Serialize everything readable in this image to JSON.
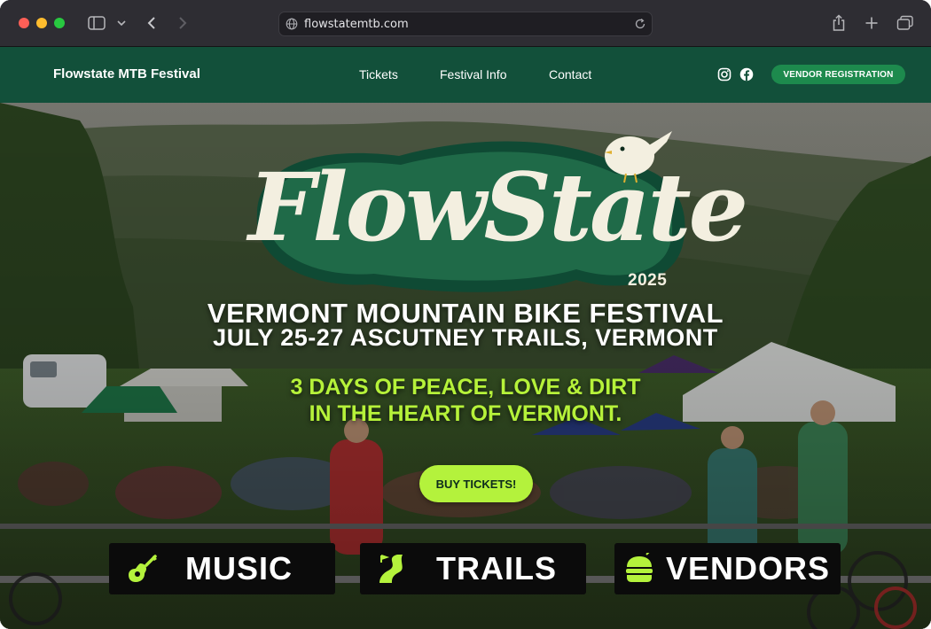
{
  "browser": {
    "url": "flowstatemtb.com"
  },
  "nav": {
    "brand": "Flowstate MTB Festival",
    "links": [
      "Tickets",
      "Festival Info",
      "Contact"
    ],
    "vendor_button": "VENDOR REGISTRATION"
  },
  "hero": {
    "logo_text": "FlowState",
    "logo_year": "2025",
    "title": "VERMONT MOUNTAIN BIKE FESTIVAL",
    "subtitle": "JULY 25-27 ASCUTNEY TRAILS, VERMONT",
    "tagline_line1": "3 DAYS OF PEACE, LOVE & DIRT",
    "tagline_line2": "IN THE HEART OF VERMONT.",
    "cta": "BUY TICKETS!"
  },
  "features": [
    {
      "label": "MUSIC",
      "icon": "guitar-icon"
    },
    {
      "label": "TRAILS",
      "icon": "trail-road-icon"
    },
    {
      "label": "VENDORS",
      "icon": "burger-icon"
    }
  ],
  "colors": {
    "nav_bg": "#12503a",
    "accent_lime": "#b4f23c",
    "vendor_button": "#1d8a4d"
  }
}
